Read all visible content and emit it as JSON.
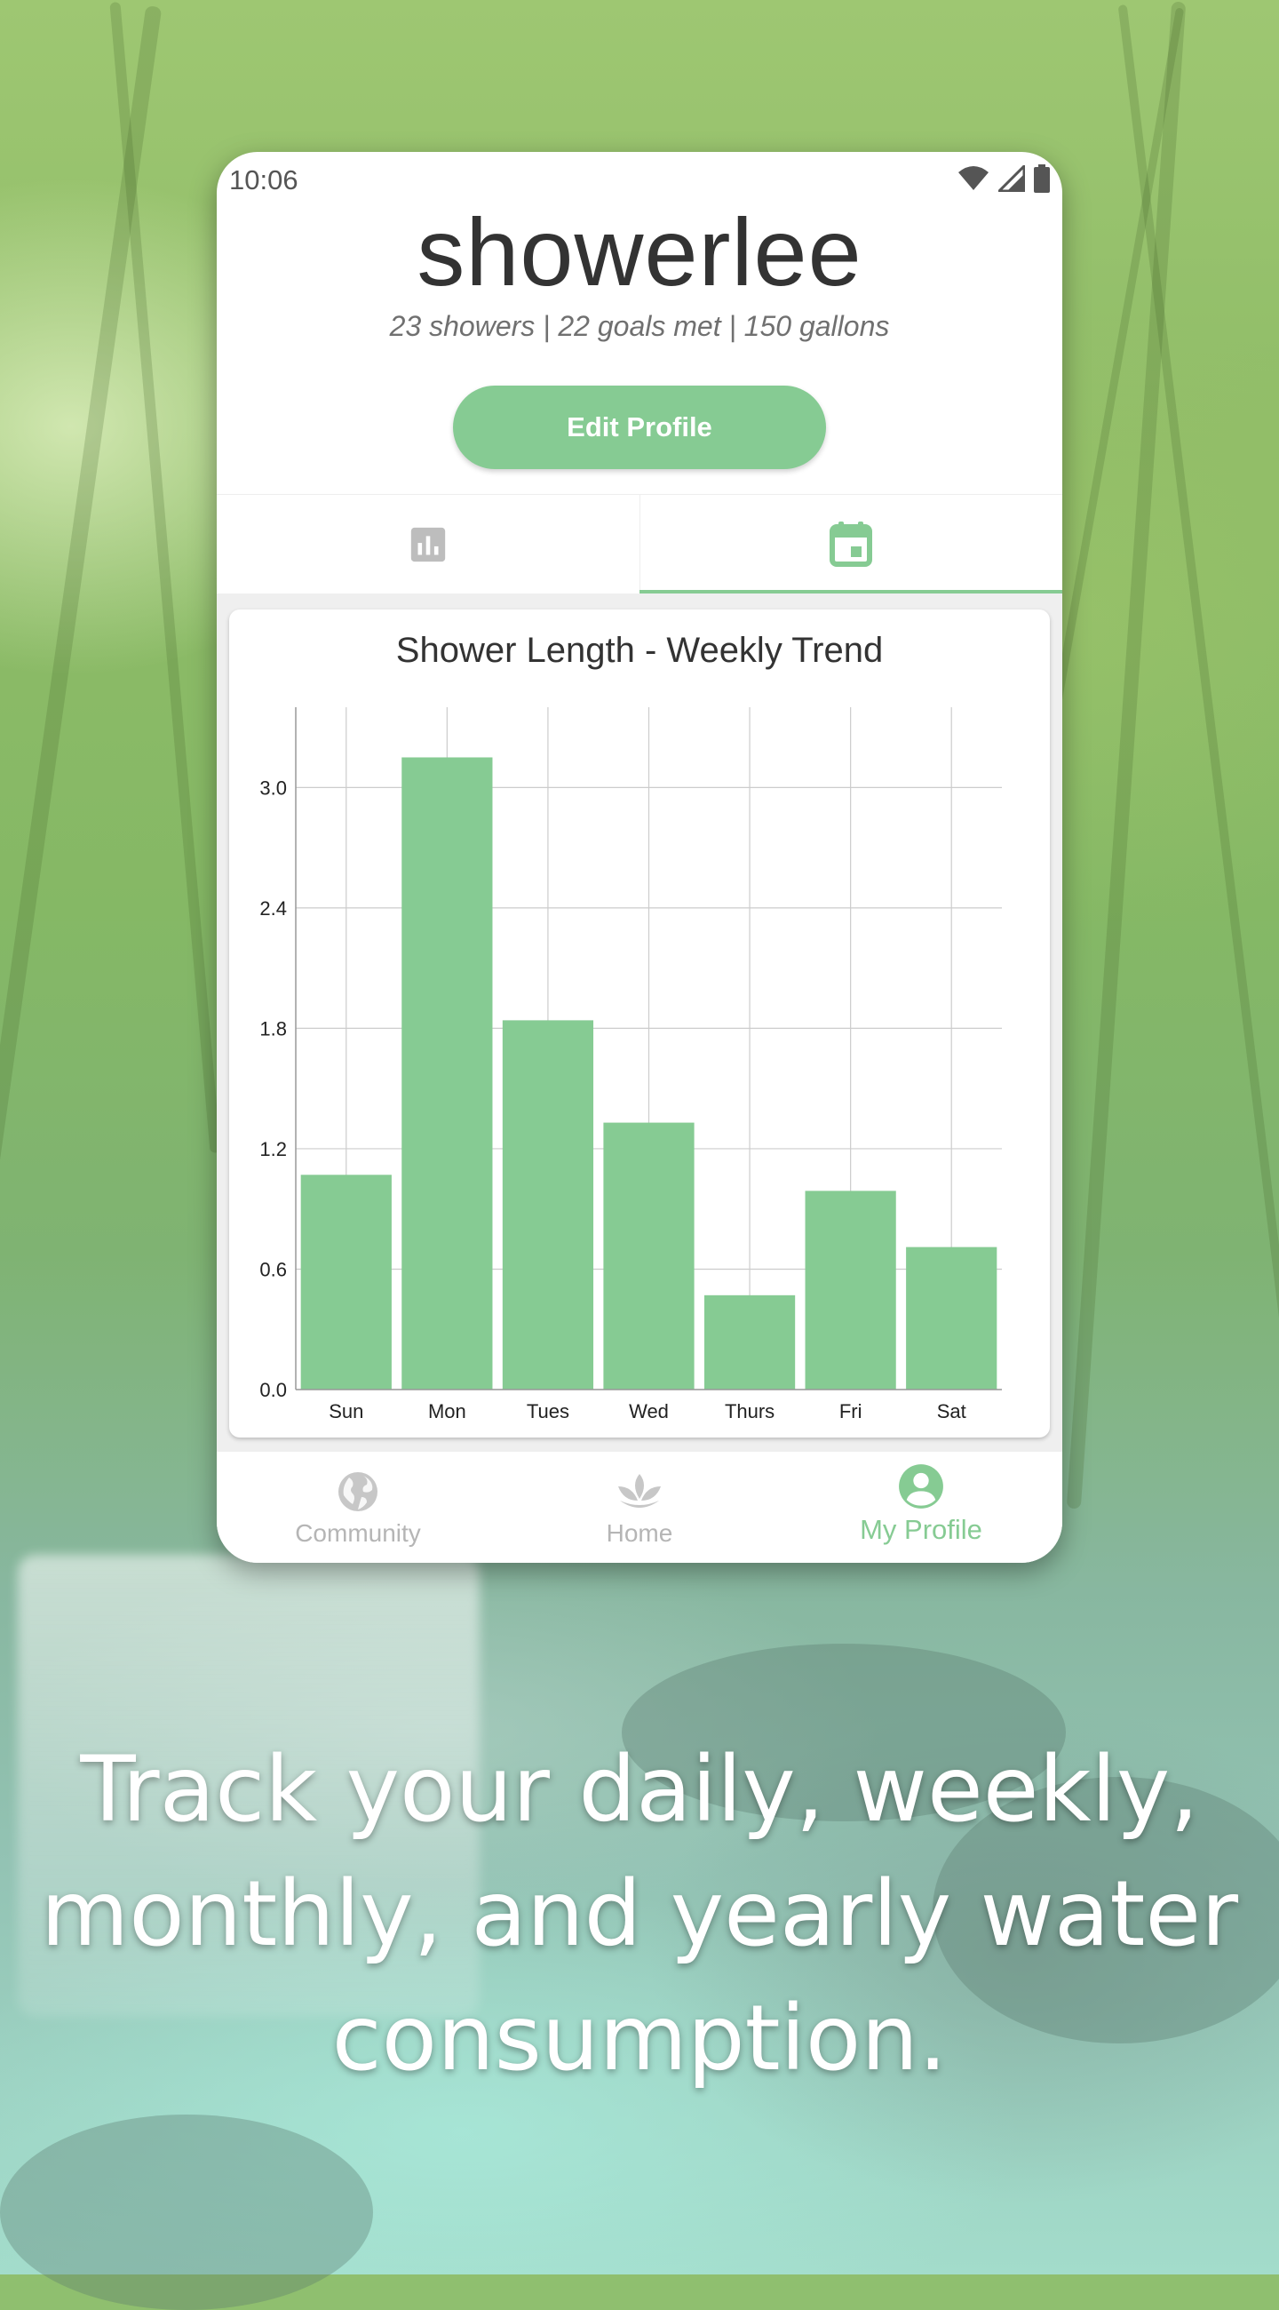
{
  "status_bar": {
    "time": "10:06",
    "icons": [
      "wifi-icon",
      "signal-icon",
      "battery-icon"
    ]
  },
  "profile": {
    "username": "showerlee",
    "stats": "23 showers | 22 goals met | 150 gallons",
    "edit_button": "Edit Profile"
  },
  "tabs": [
    {
      "icon": "bar-chart-icon",
      "active": false
    },
    {
      "icon": "calendar-icon",
      "active": true
    }
  ],
  "colors": {
    "accent": "#86cb93",
    "inactive": "#b5b5b5",
    "grid": "#cccccc"
  },
  "chart_data": {
    "type": "bar",
    "title": "Shower Length - Weekly Trend",
    "categories": [
      "Sun",
      "Mon",
      "Tues",
      "Wed",
      "Thurs",
      "Fri",
      "Sat"
    ],
    "values": [
      1.07,
      3.15,
      1.84,
      1.33,
      0.47,
      0.99,
      0.71
    ],
    "yticks": [
      "0.0",
      "0.6",
      "1.2",
      "1.8",
      "2.4",
      "3.0"
    ],
    "ylim": [
      0,
      3.4
    ],
    "grid": true,
    "bar_color": "#86cb93"
  },
  "bottom_nav": [
    {
      "label": "Community",
      "icon": "globe-icon",
      "active": false
    },
    {
      "label": "Home",
      "icon": "lotus-icon",
      "active": false
    },
    {
      "label": "My Profile",
      "icon": "account-circle-icon",
      "active": true
    }
  ],
  "tagline": "Track your daily, weekly, monthly, and yearly water consumption."
}
